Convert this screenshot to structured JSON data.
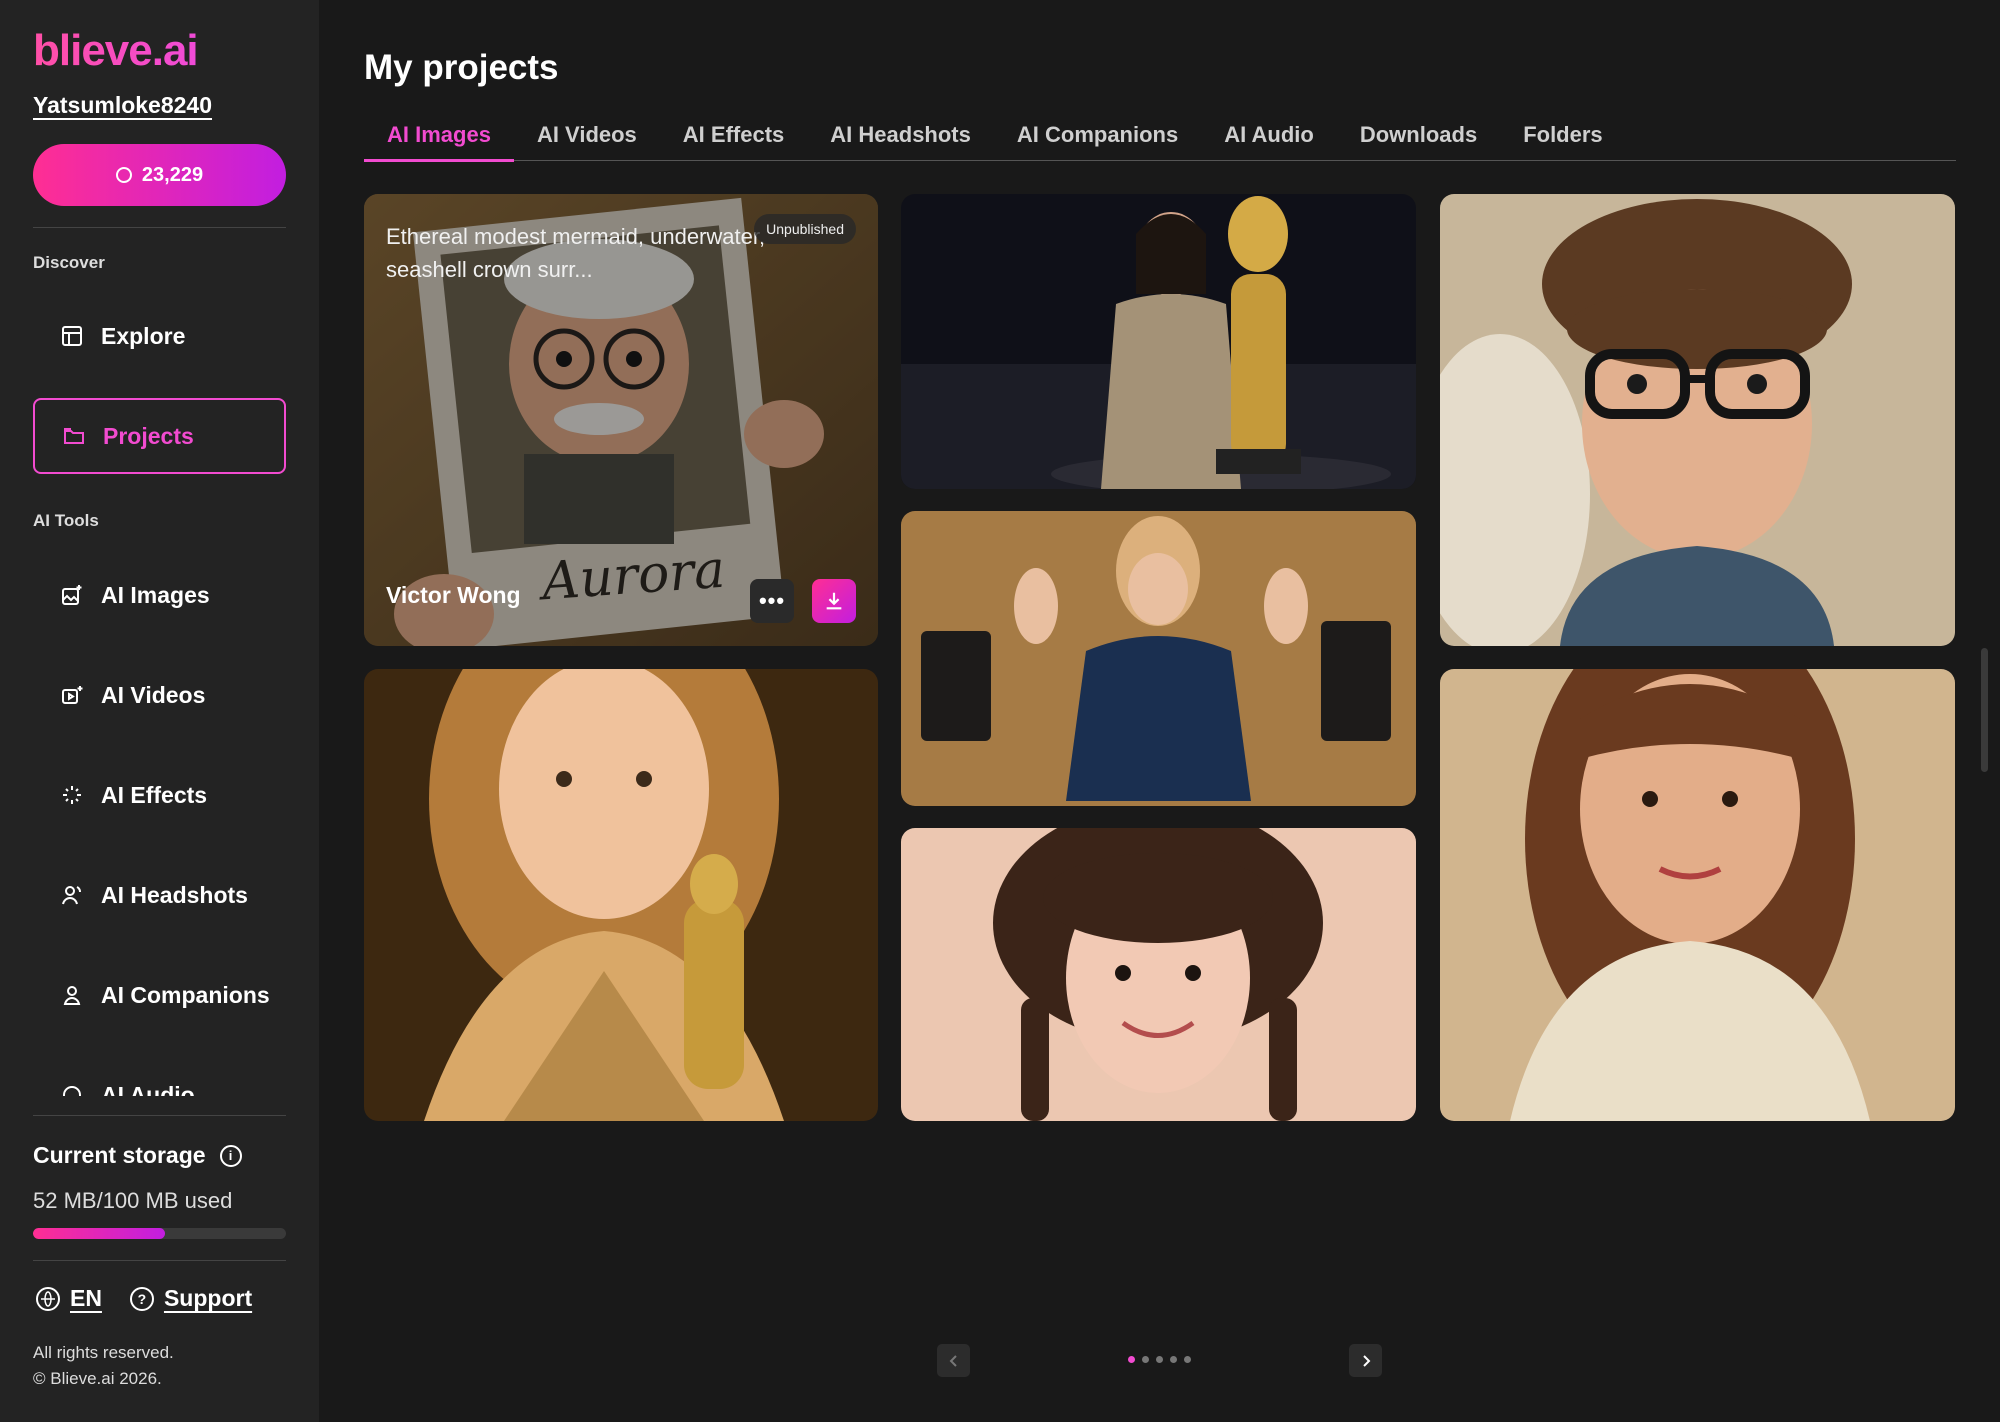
{
  "brand": {
    "logo": "blieve.ai",
    "accent": "#f24bd0"
  },
  "user": {
    "name": "Yatsumloke8240",
    "credits": "23,229"
  },
  "sidebar": {
    "discover_label": "Discover",
    "discover_items": [
      {
        "label": "Explore",
        "icon": "explore-icon"
      },
      {
        "label": "Projects",
        "icon": "folder-icon",
        "active": true
      }
    ],
    "tools_label": "AI Tools",
    "tool_items": [
      {
        "label": "AI Images",
        "icon": "image-sparkle-icon"
      },
      {
        "label": "AI Videos",
        "icon": "video-sparkle-icon"
      },
      {
        "label": "AI Effects",
        "icon": "sparkles-icon"
      },
      {
        "label": "AI Headshots",
        "icon": "headshot-icon"
      },
      {
        "label": "AI Companions",
        "icon": "companion-icon"
      },
      {
        "label": "AI Audio",
        "icon": "headphones-icon"
      }
    ]
  },
  "storage": {
    "title": "Current storage",
    "used_text": "52 MB/100 MB used",
    "used_fraction": 0.52
  },
  "footer": {
    "language": "EN",
    "support": "Support",
    "rights": "All rights reserved.",
    "copyright": "© Blieve.ai 2026."
  },
  "main": {
    "title": "My projects",
    "tabs": [
      "AI Images",
      "AI Videos",
      "AI Effects",
      "AI Headshots",
      "AI Companions",
      "AI Audio",
      "Downloads",
      "Folders"
    ],
    "active_tab": 0,
    "featured_card": {
      "description": "Ethereal modest mermaid, underwater, seashell crown surr...",
      "badge": "Unpublished",
      "author": "Victor Wong",
      "polaroid_caption": "Aurora"
    }
  },
  "pagination": {
    "pages": 5,
    "current": 1
  }
}
